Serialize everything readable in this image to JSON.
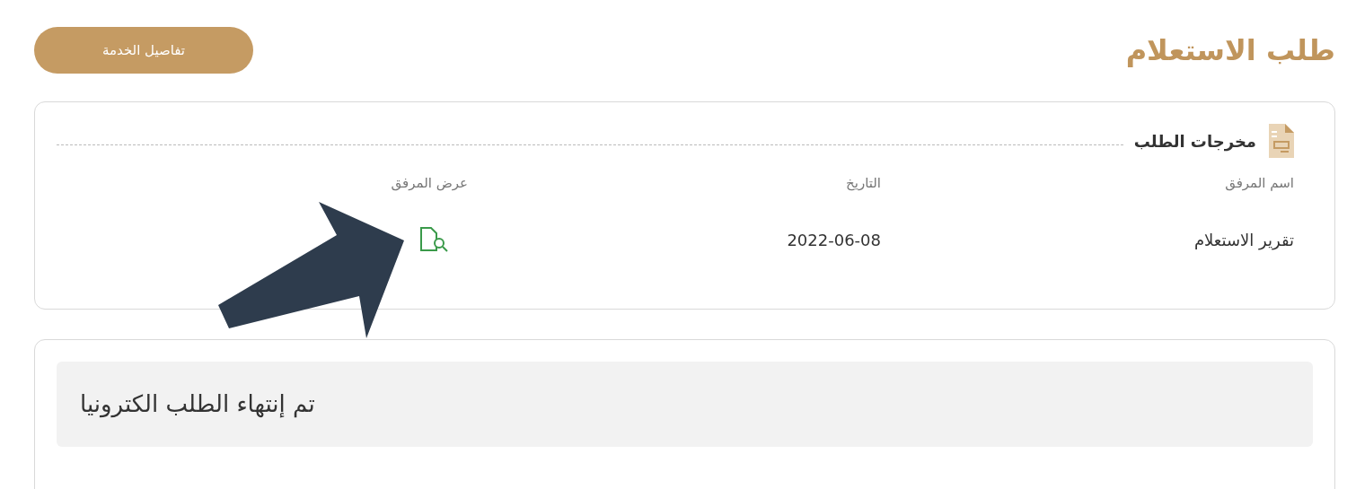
{
  "page_title": "طلب الاستعلام",
  "service_details_button": "تفاصيل الخدمة",
  "outputs_card": {
    "title": "مخرجات الطلب",
    "columns": [
      "اسم المرفق",
      "التاريخ",
      "عرض المرفق"
    ],
    "rows": [
      {
        "attachment_name": "تقرير الاستعلام",
        "date": "2022-06-08"
      }
    ]
  },
  "status_message": "تم إنتهاء الطلب الكترونيا"
}
